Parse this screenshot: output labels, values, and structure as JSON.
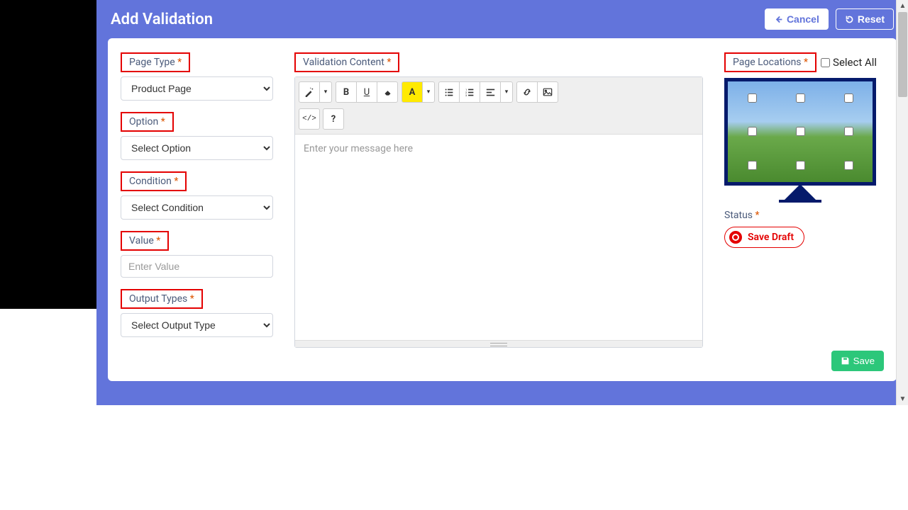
{
  "header": {
    "title": "Add Validation",
    "cancel": "Cancel",
    "reset": "Reset"
  },
  "left": {
    "page_type_label": "Page Type",
    "page_type_value": "Product Page",
    "option_label": "Option",
    "option_value": "Select Option",
    "condition_label": "Condition",
    "condition_value": "Select Condition",
    "value_label": "Value",
    "value_placeholder": "Enter Value",
    "output_label": "Output Types",
    "output_value": "Select Output Type"
  },
  "mid": {
    "content_label": "Validation Content",
    "placeholder": "Enter your message here"
  },
  "right": {
    "locations_label": "Page Locations",
    "select_all": "Select All",
    "status_label": "Status",
    "save_draft": "Save Draft"
  },
  "footer": {
    "save": "Save"
  }
}
